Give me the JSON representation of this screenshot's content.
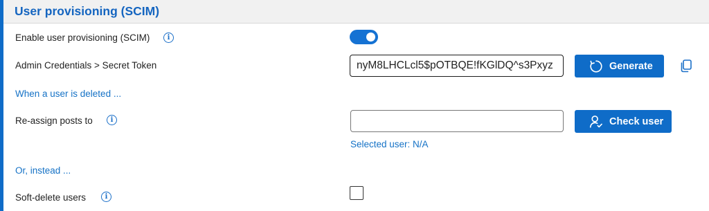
{
  "header": {
    "title": "User provisioning (SCIM)"
  },
  "provisioning": {
    "label": "Enable user provisioning (SCIM)",
    "enabled": true,
    "info_icon": "i"
  },
  "secret_token": {
    "label": "Admin Credentials > Secret Token",
    "value": "nyM8LHCLcl5$pOTBQE!fKGlDQ^s3Pxyz",
    "generate_label": "Generate",
    "generate_icon": "refresh-icon",
    "copy_icon": "copy-icon"
  },
  "deleted_section": {
    "link": "When a user is deleted ..."
  },
  "reassign": {
    "label": "Re-assign posts to",
    "info_icon": "i",
    "input_value": "",
    "check_label": "Check user",
    "check_icon": "person-icon",
    "selected_user_text": "Selected user: N/A"
  },
  "instead_section": {
    "link": "Or, instead ..."
  },
  "soft_delete": {
    "label": "Soft-delete users",
    "info_icon": "i",
    "checked": false
  },
  "colors": {
    "accent": "#0f6cc8",
    "link": "#1572c6",
    "header_bg": "#f1f1f1"
  }
}
